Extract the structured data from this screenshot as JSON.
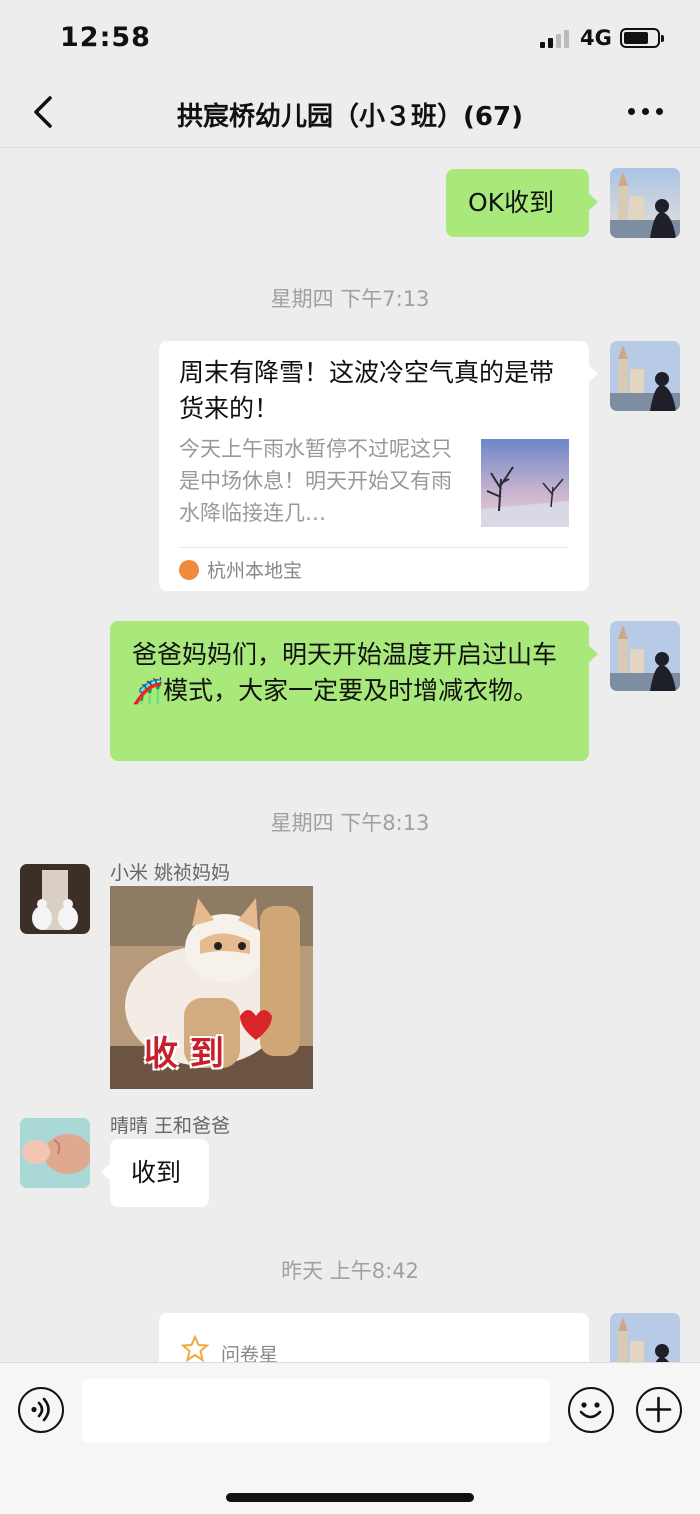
{
  "status_bar": {
    "time": "12:58",
    "network": "4G"
  },
  "nav": {
    "title": "拱宸桥幼儿园（小３班）(67)"
  },
  "messages": {
    "m1_text": "OK收到",
    "ts1": "星期四 下午7:13",
    "card1": {
      "title": "周末有降雪！这波冷空气真的是带货来的！",
      "desc": "今天上午雨水暂停不过呢这只是中场休息！明天开始又有雨水降临接连几…",
      "source": "杭州本地宝"
    },
    "m2_text": "爸爸妈妈们，明天开始温度开启过山车🎢模式，大家一定要及时增减衣物。",
    "ts2": "星期四 下午8:13",
    "sender1": "小米  姚祯妈妈",
    "sticker_text": "收 到",
    "sender2": "晴晴  王和爸爸",
    "m3_text": "收到",
    "ts3": "昨天 上午8:42",
    "card2_source": "问卷星"
  },
  "input": {
    "placeholder": ""
  },
  "colors": {
    "bubble_self": "#a9e97b",
    "background": "#ededed",
    "bubble_other": "#ffffff"
  },
  "icons": [
    "back-arrow-icon",
    "more-dots-icon",
    "voice-icon",
    "emoji-icon",
    "plus-icon",
    "star-icon"
  ]
}
